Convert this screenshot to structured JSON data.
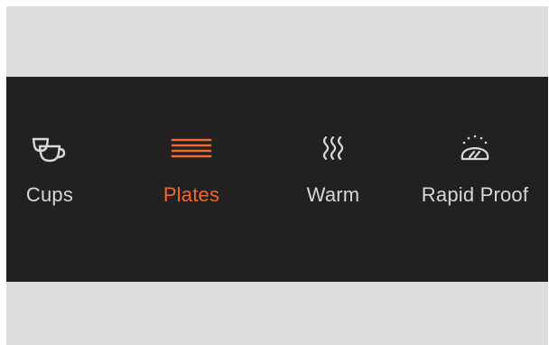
{
  "colors": {
    "background_band": "#dcdcdc",
    "bar": "#222020",
    "inactive": "#d8d8d8",
    "active": "#ee6a2c"
  },
  "modes": [
    {
      "label": "Cups",
      "icon": "cup-icon",
      "active": false
    },
    {
      "label": "Plates",
      "icon": "plates-icon",
      "active": true
    },
    {
      "label": "Warm",
      "icon": "warm-icon",
      "active": false
    },
    {
      "label": "Rapid Proof",
      "icon": "bread-icon",
      "active": false
    }
  ]
}
